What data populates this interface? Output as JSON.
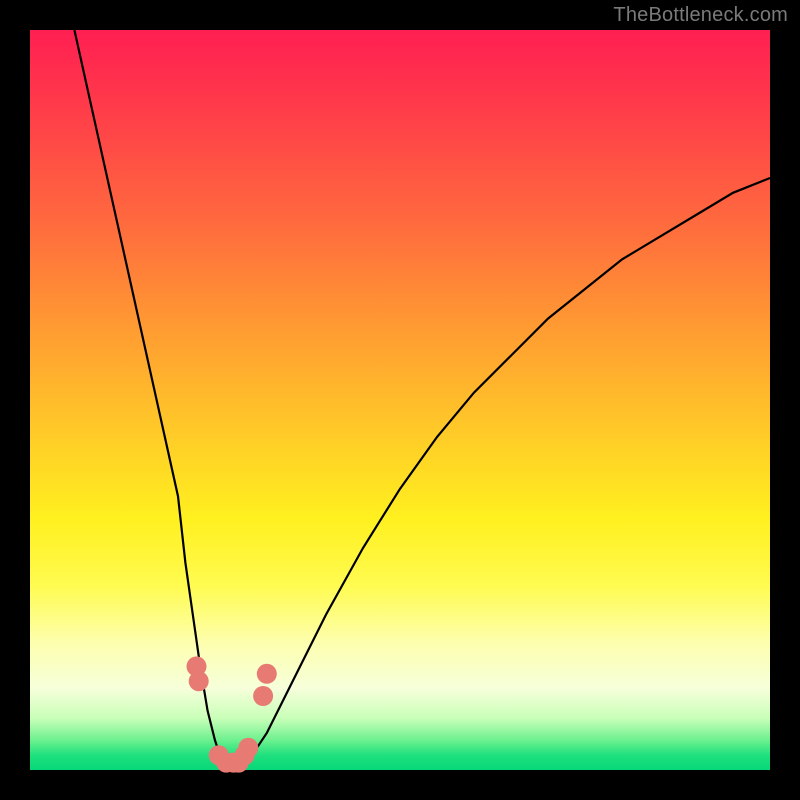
{
  "watermark": "TheBottleneck.com",
  "colors": {
    "frame": "#000000",
    "curve": "#000000",
    "marker": "#e77b74",
    "gradient_top": "#ff1f52",
    "gradient_bottom": "#06d879"
  },
  "chart_data": {
    "type": "line",
    "title": "",
    "xlabel": "",
    "ylabel": "",
    "xlim": [
      0,
      100
    ],
    "ylim": [
      0,
      100
    ],
    "x": [
      6,
      8,
      10,
      12,
      14,
      16,
      18,
      20,
      21,
      22,
      23,
      24,
      25,
      26,
      27,
      28,
      30,
      32,
      34,
      36,
      40,
      45,
      50,
      55,
      60,
      65,
      70,
      75,
      80,
      85,
      90,
      95,
      100
    ],
    "values": [
      100,
      91,
      82,
      73,
      64,
      55,
      46,
      37,
      28,
      21,
      14,
      8,
      4,
      1,
      0,
      0,
      2,
      5,
      9,
      13,
      21,
      30,
      38,
      45,
      51,
      56,
      61,
      65,
      69,
      72,
      75,
      78,
      80
    ],
    "markers": {
      "x": [
        22.5,
        22.8,
        25.5,
        26.5,
        27.5,
        28.2,
        29.0,
        29.5,
        31.5,
        32.0
      ],
      "y": [
        14,
        12,
        2,
        1,
        1,
        1,
        2,
        3,
        10,
        13
      ]
    }
  }
}
